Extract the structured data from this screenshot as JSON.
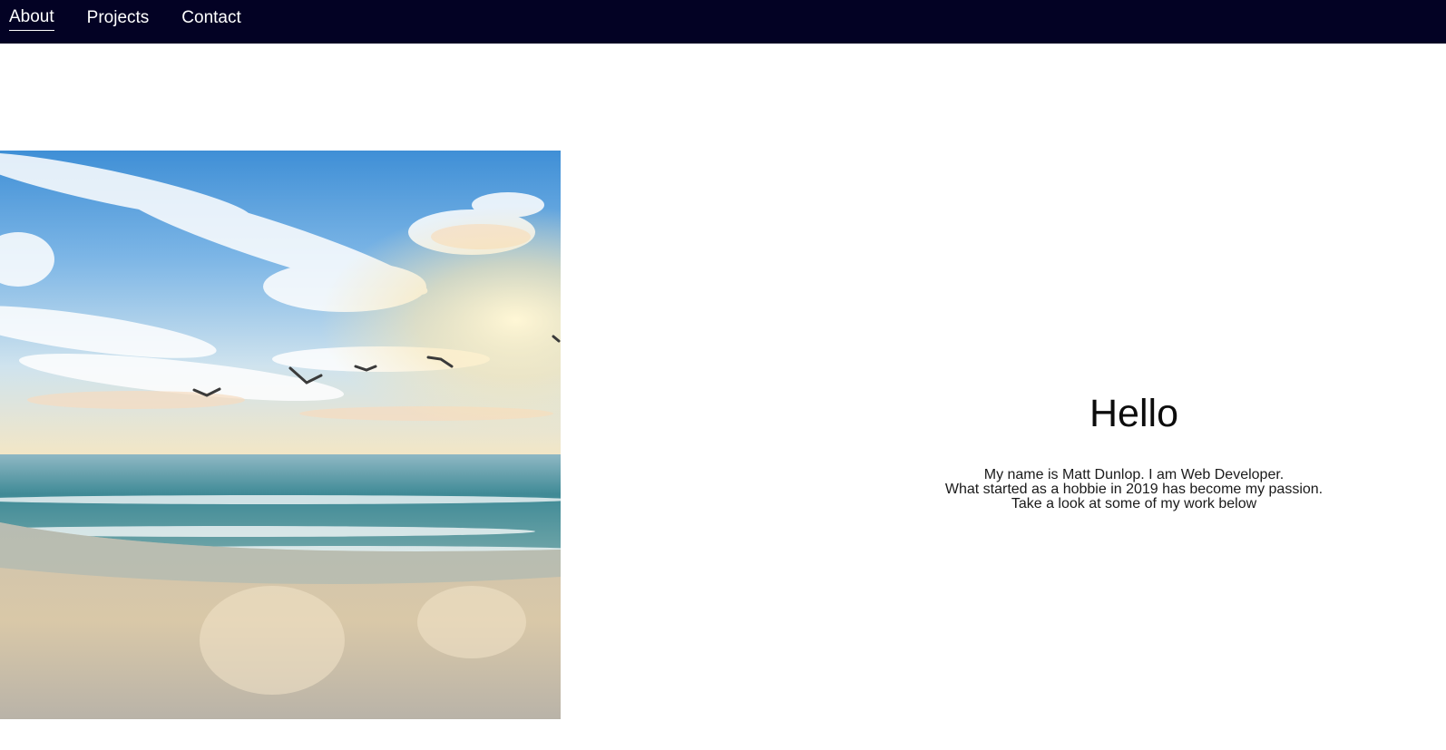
{
  "nav": {
    "items": [
      {
        "label": "About",
        "active": true
      },
      {
        "label": "Projects",
        "active": false
      },
      {
        "label": "Contact",
        "active": false
      }
    ],
    "background": "#030224"
  },
  "hero": {
    "image_subject": "beach-seascape-with-seagulls"
  },
  "intro": {
    "heading": "Hello",
    "lines": [
      "My name is Matt Dunlop. I am Web Developer.",
      "What started as a hobbie in 2019 has become my passion.",
      "Take a look at some of my work below"
    ]
  }
}
